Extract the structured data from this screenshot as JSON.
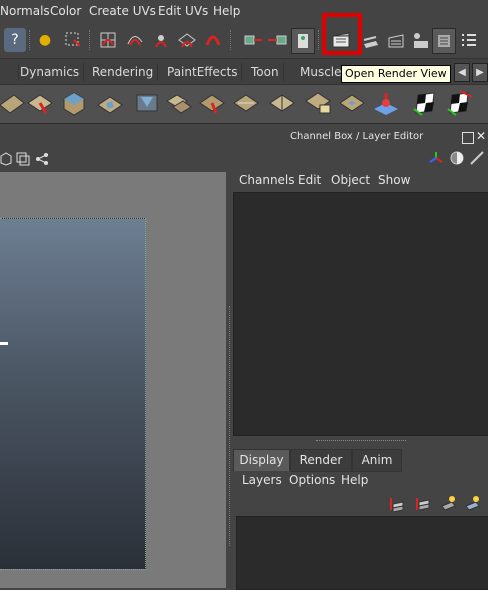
{
  "menu": {
    "items": [
      "Normals",
      "Color",
      "Create UVs",
      "Edit UVs",
      "Help"
    ]
  },
  "shelf_tabs": [
    "Dynamics",
    "Rendering",
    "PaintEffects",
    "Toon",
    "Muscle"
  ],
  "tooltip": "Open Render View",
  "channel_box": {
    "title": "Channel Box / Layer Editor",
    "menu": [
      "Channels",
      "Edit",
      "Object",
      "Show"
    ]
  },
  "layer_editor": {
    "tabs": [
      "Display",
      "Render",
      "Anim"
    ],
    "active_tab": "Display",
    "menu": [
      "Layers",
      "Options",
      "Help"
    ]
  },
  "colors": {
    "highlight": "#e00000",
    "tooltip_bg": "#ffffe1",
    "ui_bg": "#444444"
  }
}
